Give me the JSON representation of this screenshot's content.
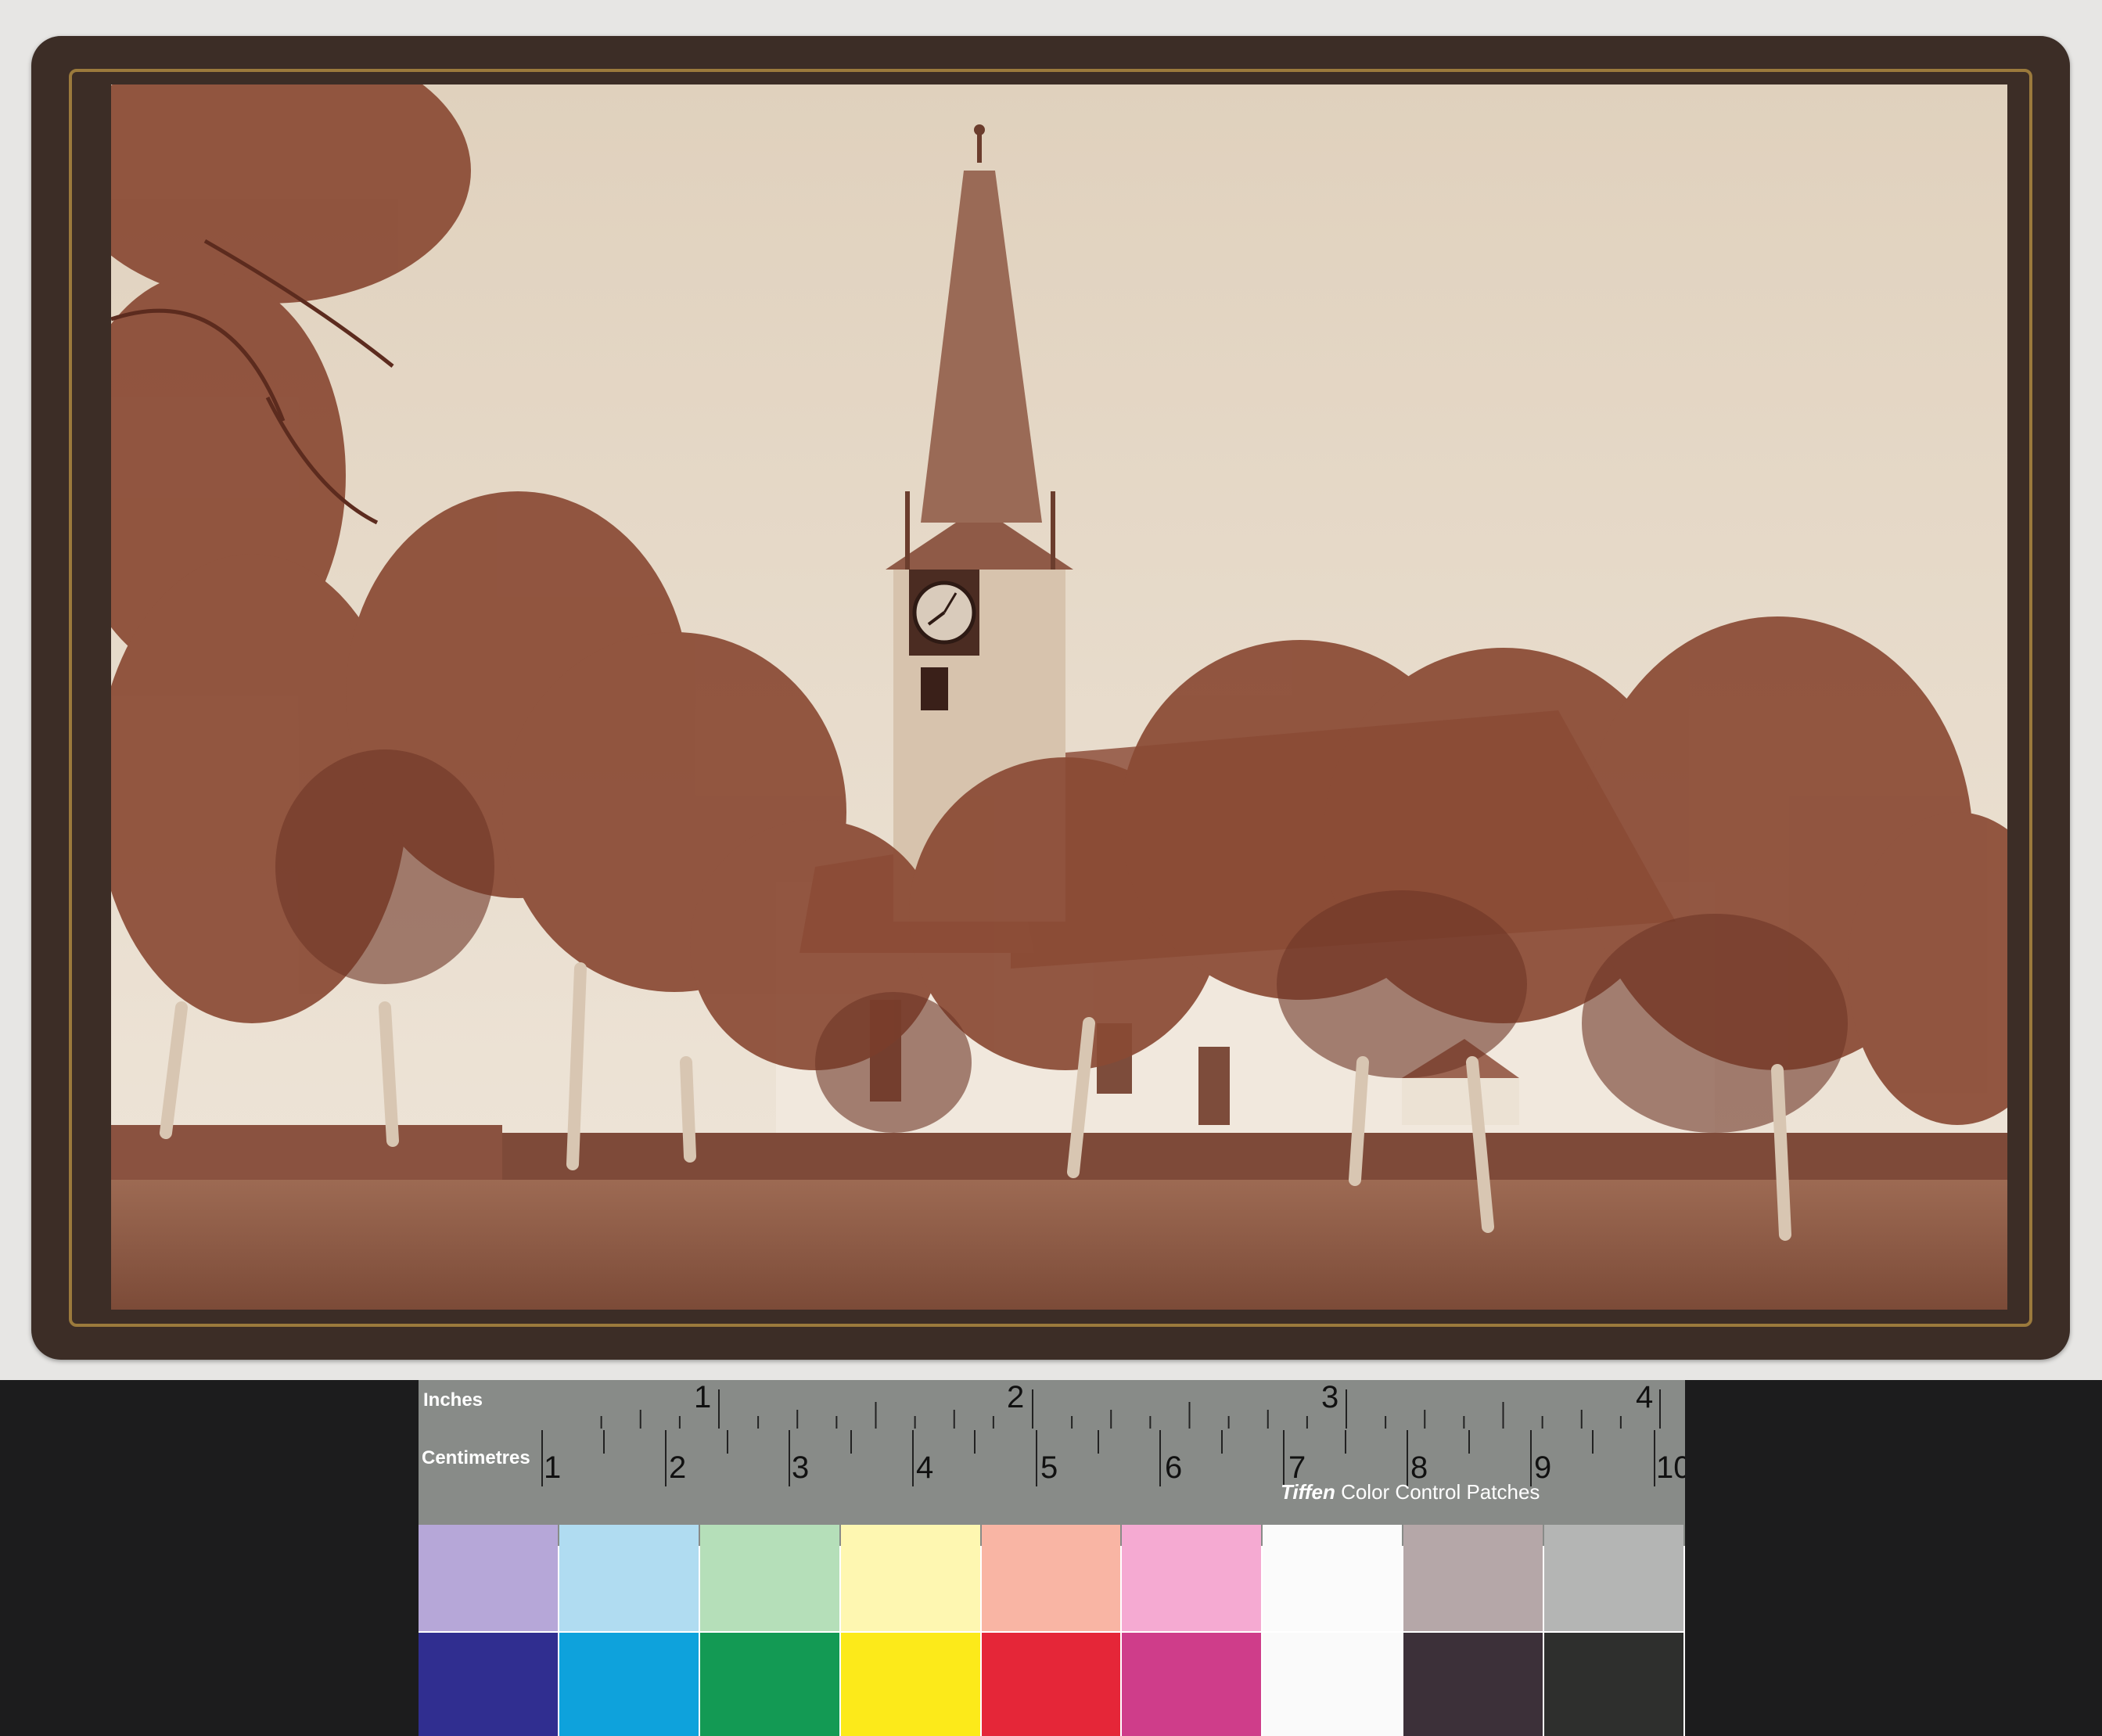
{
  "ruler": {
    "inches_label": "Inches",
    "centimetres_label": "Centimetres",
    "inch_numbers": [
      "1",
      "2",
      "3",
      "4"
    ],
    "cm_numbers": [
      "1",
      "2",
      "3",
      "4",
      "5",
      "6",
      "7",
      "8",
      "9",
      "10"
    ]
  },
  "color_control": {
    "brand": "Tiffen",
    "title": "Color Control Patches",
    "patches": [
      {
        "label": "Blue",
        "light": "#b6a7d8",
        "dark": "#302e90"
      },
      {
        "label": "Cyan",
        "light": "#b0dcf1",
        "dark": "#0ea2dc"
      },
      {
        "label": "Green",
        "light": "#b5dfb9",
        "dark": "#139a54"
      },
      {
        "label": "Yellow",
        "light": "#fef7b1",
        "dark": "#fcea1a"
      },
      {
        "label": "Red",
        "light": "#f9b5a4",
        "dark": "#e52638"
      },
      {
        "label": "Magenta",
        "light": "#f5aad2",
        "dark": "#cf3d8a"
      },
      {
        "label": "White",
        "light": "#fbfbfb",
        "dark": "#fafafa"
      },
      {
        "label": "3/Color",
        "light": "#b5a7a8",
        "dark": "#3c3039"
      },
      {
        "label": "Black",
        "light": "#b4b5b4",
        "dark": "#2e2f2d"
      }
    ]
  },
  "colors": {
    "mount": "#3c2d26",
    "mount_gilt_line": "#9b7a3c",
    "sky": "#e8dccb",
    "foliage": "#8a4a34",
    "background": "#e7e6e4"
  }
}
